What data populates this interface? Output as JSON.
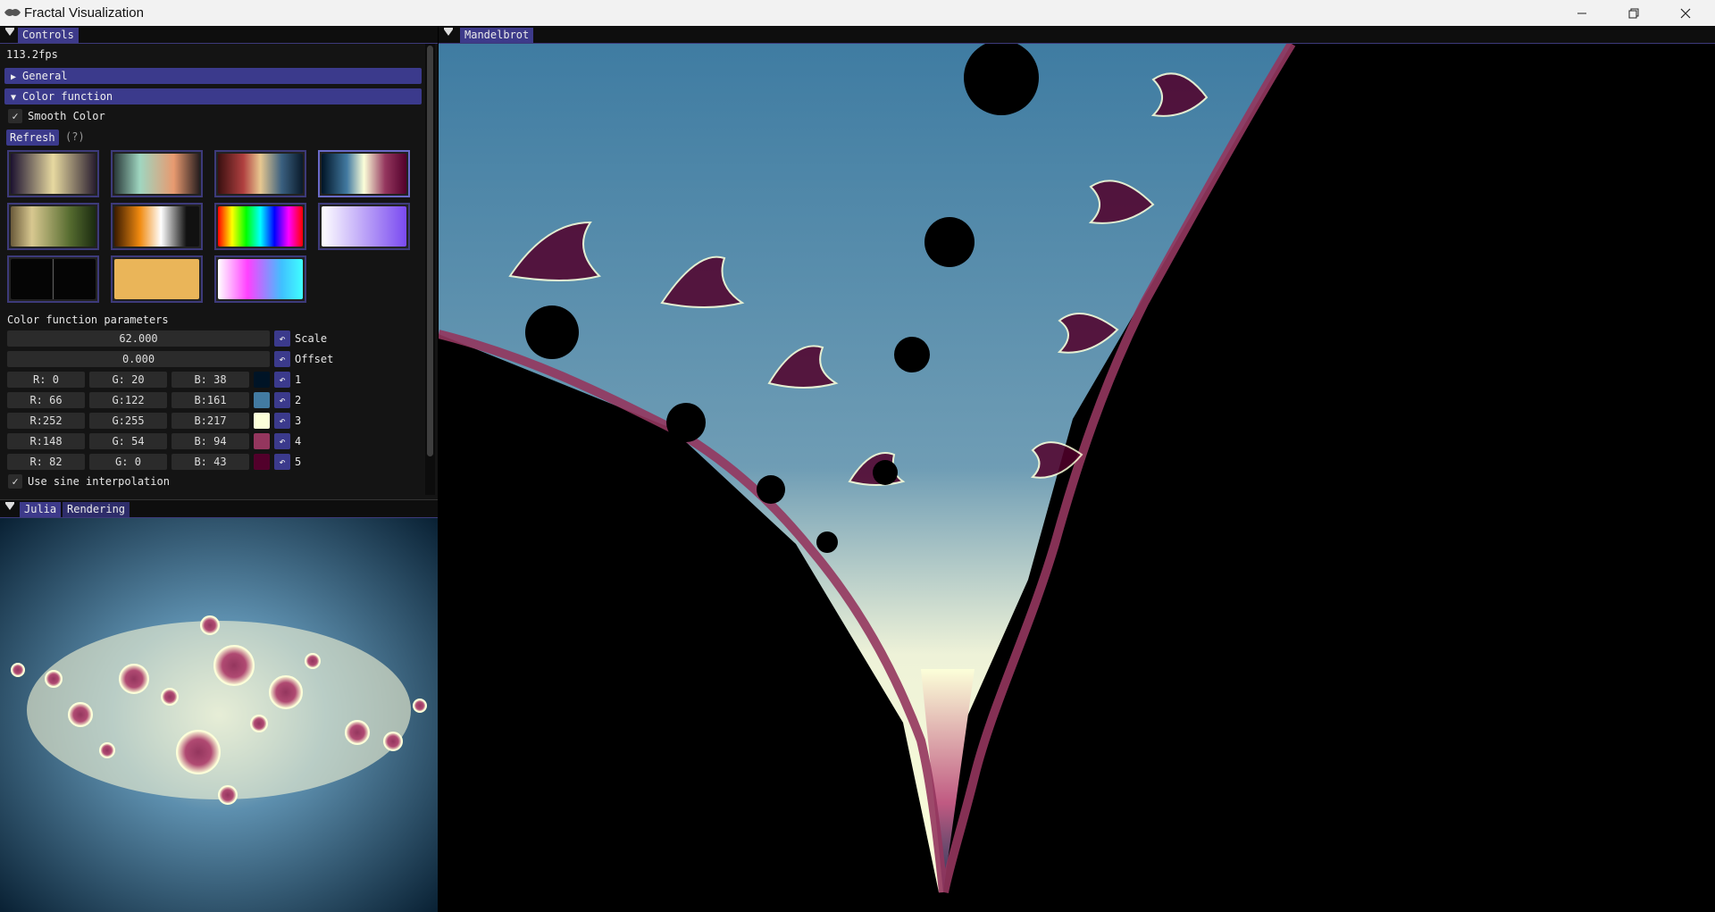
{
  "window": {
    "title": "Fractal Visualization",
    "minimize_icon": "minimize-icon",
    "restore_icon": "restore-icon",
    "close_icon": "close-icon"
  },
  "controls": {
    "tab": "Controls",
    "fps": "113.2fps",
    "sections": {
      "general": "General",
      "color_function": "Color function"
    },
    "smooth_color": {
      "label": "Smooth Color",
      "checked": true
    },
    "refresh_label": "Refresh",
    "help_label": "(?)",
    "presets_selected_index": 3,
    "params_title": "Color function parameters",
    "scale": {
      "value": "62.000",
      "label": "Scale"
    },
    "offset": {
      "value": "0.000",
      "label": "Offset"
    },
    "colors": [
      {
        "r": "R:  0",
        "g": "G: 20",
        "b": "B: 38",
        "hex": "#001426",
        "label": "1"
      },
      {
        "r": "R: 66",
        "g": "G:122",
        "b": "B:161",
        "hex": "#427aa1",
        "label": "2"
      },
      {
        "r": "R:252",
        "g": "G:255",
        "b": "B:217",
        "hex": "#fcffd9",
        "label": "3"
      },
      {
        "r": "R:148",
        "g": "G: 54",
        "b": "B: 94",
        "hex": "#94365e",
        "label": "4"
      },
      {
        "r": "R: 82",
        "g": "G:  0",
        "b": "B: 43",
        "hex": "#52002b",
        "label": "5"
      }
    ],
    "sine_interpolation": {
      "label": "Use sine interpolation",
      "checked": true
    }
  },
  "julia_panel": {
    "tabs": [
      "Julia",
      "Rendering"
    ]
  },
  "mandelbrot_panel": {
    "tab": "Mandelbrot"
  },
  "accent": "#3b3a8c"
}
